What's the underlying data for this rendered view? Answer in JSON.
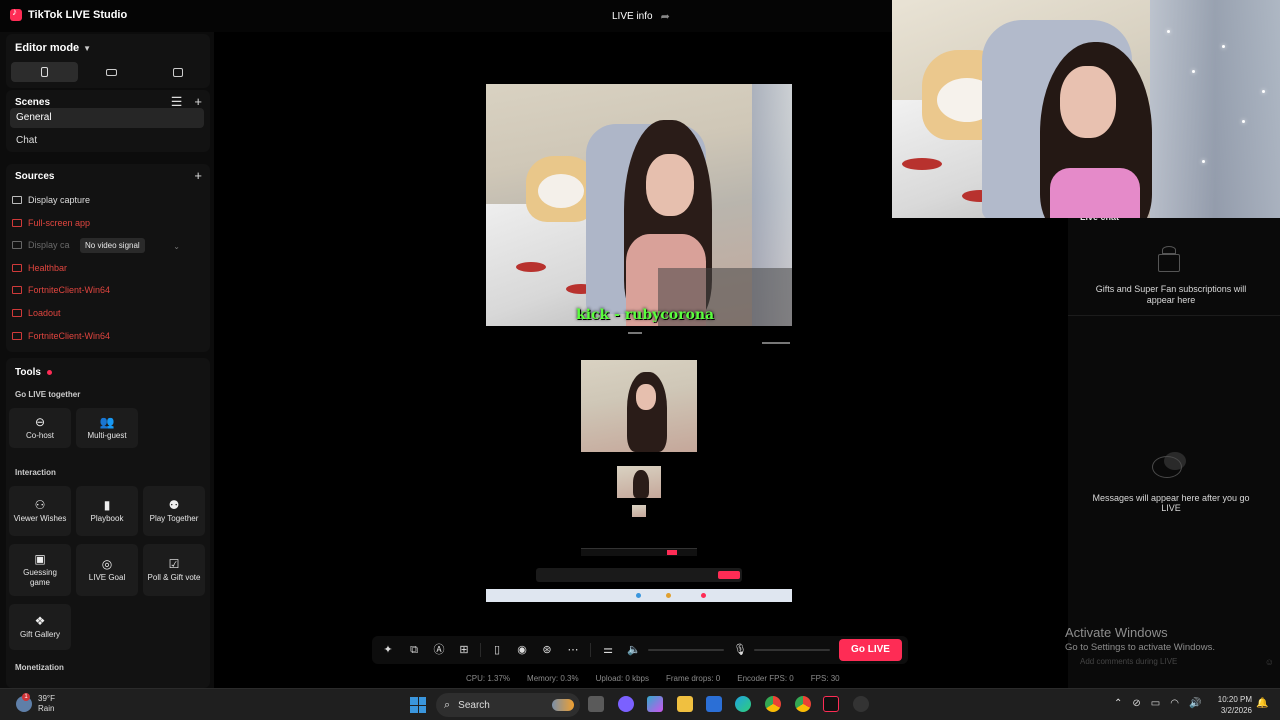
{
  "app": {
    "title": "TikTok LIVE Studio",
    "live_info": "LIVE info"
  },
  "editor": {
    "title": "Editor mode"
  },
  "scenes": {
    "title": "Scenes",
    "items": [
      {
        "label": "General",
        "active": true
      },
      {
        "label": "Chat",
        "active": false
      }
    ]
  },
  "sources": {
    "title": "Sources",
    "items": [
      {
        "label": "Display capture",
        "state": "normal"
      },
      {
        "label": "Full-screen app",
        "state": "error"
      },
      {
        "label": "Display ca",
        "state": "disabled"
      },
      {
        "label": "Healthbar",
        "state": "error"
      },
      {
        "label": "FortniteClient-Win64",
        "state": "error"
      },
      {
        "label": "Loadout",
        "state": "error"
      },
      {
        "label": "FortniteClient-Win64",
        "state": "error"
      }
    ],
    "tooltip": "No video signal"
  },
  "tools": {
    "title": "Tools",
    "go_live_together": "Go LIVE together",
    "cohost": "Co-host",
    "multiguest": "Multi-guest",
    "interaction": "Interaction",
    "viewer_wishes": "Viewer Wishes",
    "playbook": "Playbook",
    "play_together": "Play Together",
    "guessing_game": "Guessing game",
    "live_goal": "LIVE Goal",
    "poll_gift_vote": "Poll & Gift vote",
    "gift_gallery": "Gift Gallery",
    "monetization": "Monetization"
  },
  "preview": {
    "overlay_text": "kick - rubycorona"
  },
  "right_panel": {
    "live_chat_title": "Live chat",
    "gifts_text": "Gifts and Super Fan subscriptions will appear here",
    "messages_text": "Messages will appear here after you go LIVE",
    "comment_placeholder": "Add comments during LIVE",
    "activate_title": "Activate Windows",
    "activate_sub": "Go to Settings to activate Windows."
  },
  "toolbar": {
    "go_live": "Go LIVE"
  },
  "stats": {
    "cpu": "CPU: 1.37%",
    "memory": "Memory: 0.3%",
    "upload": "Upload: 0 kbps",
    "frame_drops": "Frame drops: 0",
    "encoder_fps": "Encoder FPS: 0",
    "fps": "FPS: 30"
  },
  "taskbar": {
    "temp": "39°F",
    "weather": "Rain",
    "notification_count": "1",
    "search": "Search",
    "time": "10:20 PM",
    "date": "3/2/2026"
  },
  "colors": {
    "accent": "#fe2c55",
    "error": "#e0453f",
    "overlay_text": "#5bff3e"
  }
}
